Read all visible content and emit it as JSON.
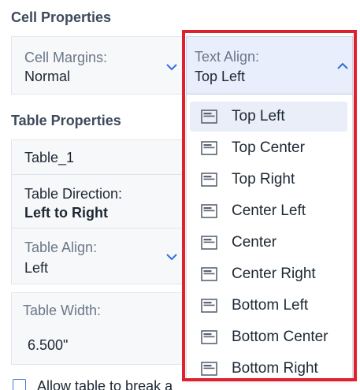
{
  "cell_properties": {
    "title": "Cell Properties",
    "cell_margins": {
      "label": "Cell Margins:",
      "value": "Normal"
    },
    "text_align": {
      "label": "Text Align:",
      "value": "Top Left",
      "options": [
        {
          "label": "Top Left",
          "selected": true
        },
        {
          "label": "Top Center",
          "selected": false
        },
        {
          "label": "Top Right",
          "selected": false
        },
        {
          "label": "Center Left",
          "selected": false
        },
        {
          "label": "Center",
          "selected": false
        },
        {
          "label": "Center Right",
          "selected": false
        },
        {
          "label": "Bottom Left",
          "selected": false
        },
        {
          "label": "Bottom Center",
          "selected": false
        },
        {
          "label": "Bottom Right",
          "selected": false
        }
      ]
    }
  },
  "table_properties": {
    "title": "Table Properties",
    "table_name": "Table_1",
    "table_direction": {
      "label": "Table Direction:",
      "value": "Left to Right"
    },
    "table_align": {
      "label": "Table Align:",
      "value": "Left"
    },
    "table_width": {
      "label": "Table Width:",
      "value": "6.500\""
    }
  },
  "allow_break": {
    "label": "Allow table to break a",
    "checked": false
  },
  "colors": {
    "accent": "#2f6fe0",
    "highlight_box": "#e0202e",
    "selected_bg": "#e9eef8"
  }
}
